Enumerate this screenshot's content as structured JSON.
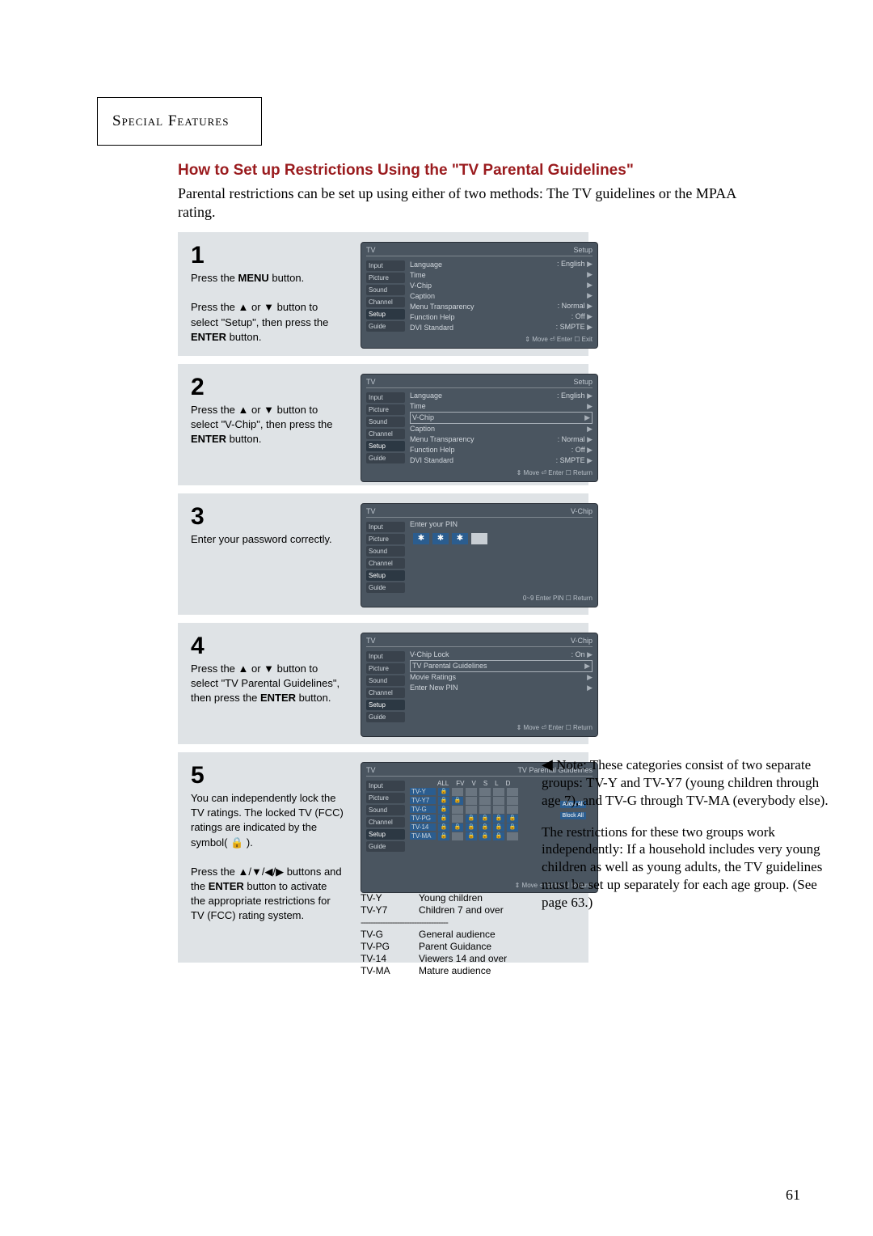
{
  "header": {
    "section_title": "Special Features"
  },
  "title": "How to Set up Restrictions Using the \"TV Parental Guidelines\"",
  "intro": "Parental restrictions can be set up using either of two methods: The TV guidelines or the MPAA rating.",
  "steps": {
    "s1": {
      "num": "1",
      "line1_pre": "Press the ",
      "line1_bold": "MENU",
      "line1_post": " button.",
      "line2": "Press the ▲ or ▼ button to select \"Setup\", then press the ",
      "line2_bold": "ENTER",
      "line2_post": " button."
    },
    "s2": {
      "num": "2",
      "line1": "Press the ▲ or ▼ button to select \"V-Chip\", then press the ",
      "line1_bold": "ENTER",
      "line1_post": " button."
    },
    "s3": {
      "num": "3",
      "line1": "Enter your password correctly."
    },
    "s4": {
      "num": "4",
      "line1": "Press the ▲ or ▼ button to select \"TV Parental Guidelines\", then press the ",
      "line1_bold": "ENTER",
      "line1_post": " button."
    },
    "s5": {
      "num": "5",
      "para1": "You can independently lock the TV ratings. The locked TV (FCC) ratings are indicated by the symbol( 🔒 ).",
      "para2_pre": "Press the ▲/▼/◀/▶ buttons and the ",
      "para2_bold": "ENTER",
      "para2_post": " button to activate the appropriate restrictions for TV (FCC) rating system."
    }
  },
  "osd_common": {
    "tv_label": "TV",
    "nav": [
      "Input",
      "Picture",
      "Sound",
      "Channel",
      "Setup",
      "Guide"
    ]
  },
  "osd1": {
    "title": "Setup",
    "rows": [
      {
        "label": "Language",
        "value": ": English",
        "arrow": true
      },
      {
        "label": "Time",
        "value": "",
        "arrow": true
      },
      {
        "label": "V-Chip",
        "value": "",
        "arrow": true
      },
      {
        "label": "Caption",
        "value": "",
        "arrow": true
      },
      {
        "label": "Menu Transparency",
        "value": ": Normal",
        "arrow": true
      },
      {
        "label": "Function Help",
        "value": ": Off",
        "arrow": true
      },
      {
        "label": "DVI Standard",
        "value": ": SMPTE",
        "arrow": true
      }
    ],
    "hl_index": -1,
    "foot": "⇕ Move   ⏎ Enter   ☐ Exit"
  },
  "osd2": {
    "title": "Setup",
    "hl_index": 2,
    "foot": "⇕ Move   ⏎ Enter   ☐ Return"
  },
  "osd3": {
    "title": "V-Chip",
    "prompt": "Enter your PIN",
    "foot": "0~9 Enter PIN        ☐ Return"
  },
  "osd4": {
    "title": "V-Chip",
    "rows": [
      {
        "label": "V-Chip Lock",
        "value": ": On",
        "arrow": true
      },
      {
        "label": "TV Parental Guidelines",
        "value": "",
        "arrow": true
      },
      {
        "label": "Movie Ratings",
        "value": "",
        "arrow": true
      },
      {
        "label": "Enter New PIN",
        "value": "",
        "arrow": true
      }
    ],
    "hl_index": 1,
    "foot": "⇕ Move   ⏎ Enter   ☐ Return"
  },
  "osd5": {
    "title": "TV Parental Guidelines",
    "cols": [
      "ALL",
      "FV",
      "V",
      "S",
      "L",
      "D"
    ],
    "allow": "Allow All",
    "block": "Block All",
    "rows": [
      "TV-Y",
      "TV-Y7",
      "TV-G",
      "TV-PG",
      "TV-14",
      "TV-MA"
    ],
    "foot": "⇕ Move   ⏎ Enter   ☐ Return"
  },
  "ratings": {
    "group1": [
      [
        "TV-Y",
        "Young children"
      ],
      [
        "TV-Y7",
        "Children 7 and over"
      ]
    ],
    "group2": [
      [
        "TV-G",
        "General audience"
      ],
      [
        "TV-PG",
        "Parent Guidance"
      ],
      [
        "TV-14",
        "Viewers 14 and over"
      ],
      [
        "TV-MA",
        "Mature audience"
      ]
    ]
  },
  "note": {
    "p1": "Note: These categories consist of two separate groups: TV-Y and TV-Y7 (young children through age 7), and TV-G through TV-MA (everybody else).",
    "p2": "The restrictions for these two groups work independently: If a household includes very young children as well as young adults, the TV guidelines must be set up separately for each age group. (See page 63.)"
  },
  "page_number": "61"
}
